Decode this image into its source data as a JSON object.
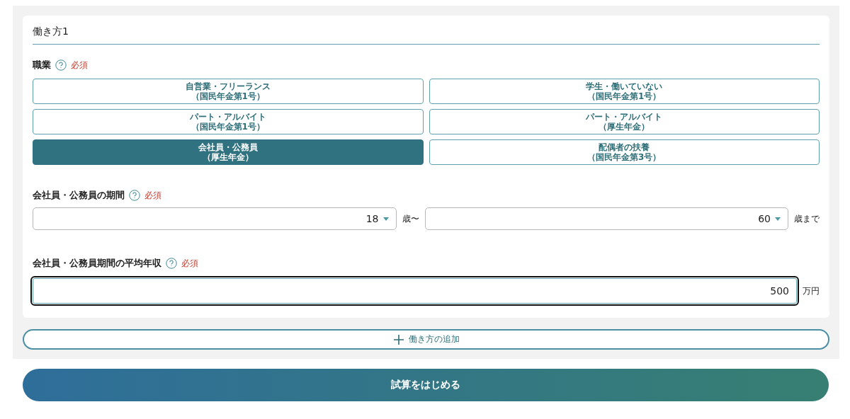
{
  "section": {
    "title": "働き方1"
  },
  "occupation": {
    "label": "職業",
    "required": "必須",
    "options": [
      {
        "line1": "自営業・フリーランス",
        "line2": "（国民年金第1号）",
        "selected": false
      },
      {
        "line1": "学生・働いていない",
        "line2": "（国民年金第1号）",
        "selected": false
      },
      {
        "line1": "パート・アルバイト",
        "line2": "（国民年金第1号）",
        "selected": false
      },
      {
        "line1": "パート・アルバイト",
        "line2": "（厚生年金）",
        "selected": false
      },
      {
        "line1": "会社員・公務員",
        "line2": "（厚生年金）",
        "selected": true
      },
      {
        "line1": "配偶者の扶養",
        "line2": "（国民年金第3号）",
        "selected": false
      }
    ]
  },
  "period": {
    "label": "会社員・公務員の期間",
    "required": "必須",
    "from": {
      "value": "18",
      "unit": "歳〜"
    },
    "to": {
      "value": "60",
      "unit": "歳まで"
    }
  },
  "income": {
    "label": "会社員・公務員期間の平均年収",
    "required": "必須",
    "value": "500",
    "unit": "万円",
    "focused": true
  },
  "add_button": "働き方の追加",
  "start_button": "試算をはじめる"
}
